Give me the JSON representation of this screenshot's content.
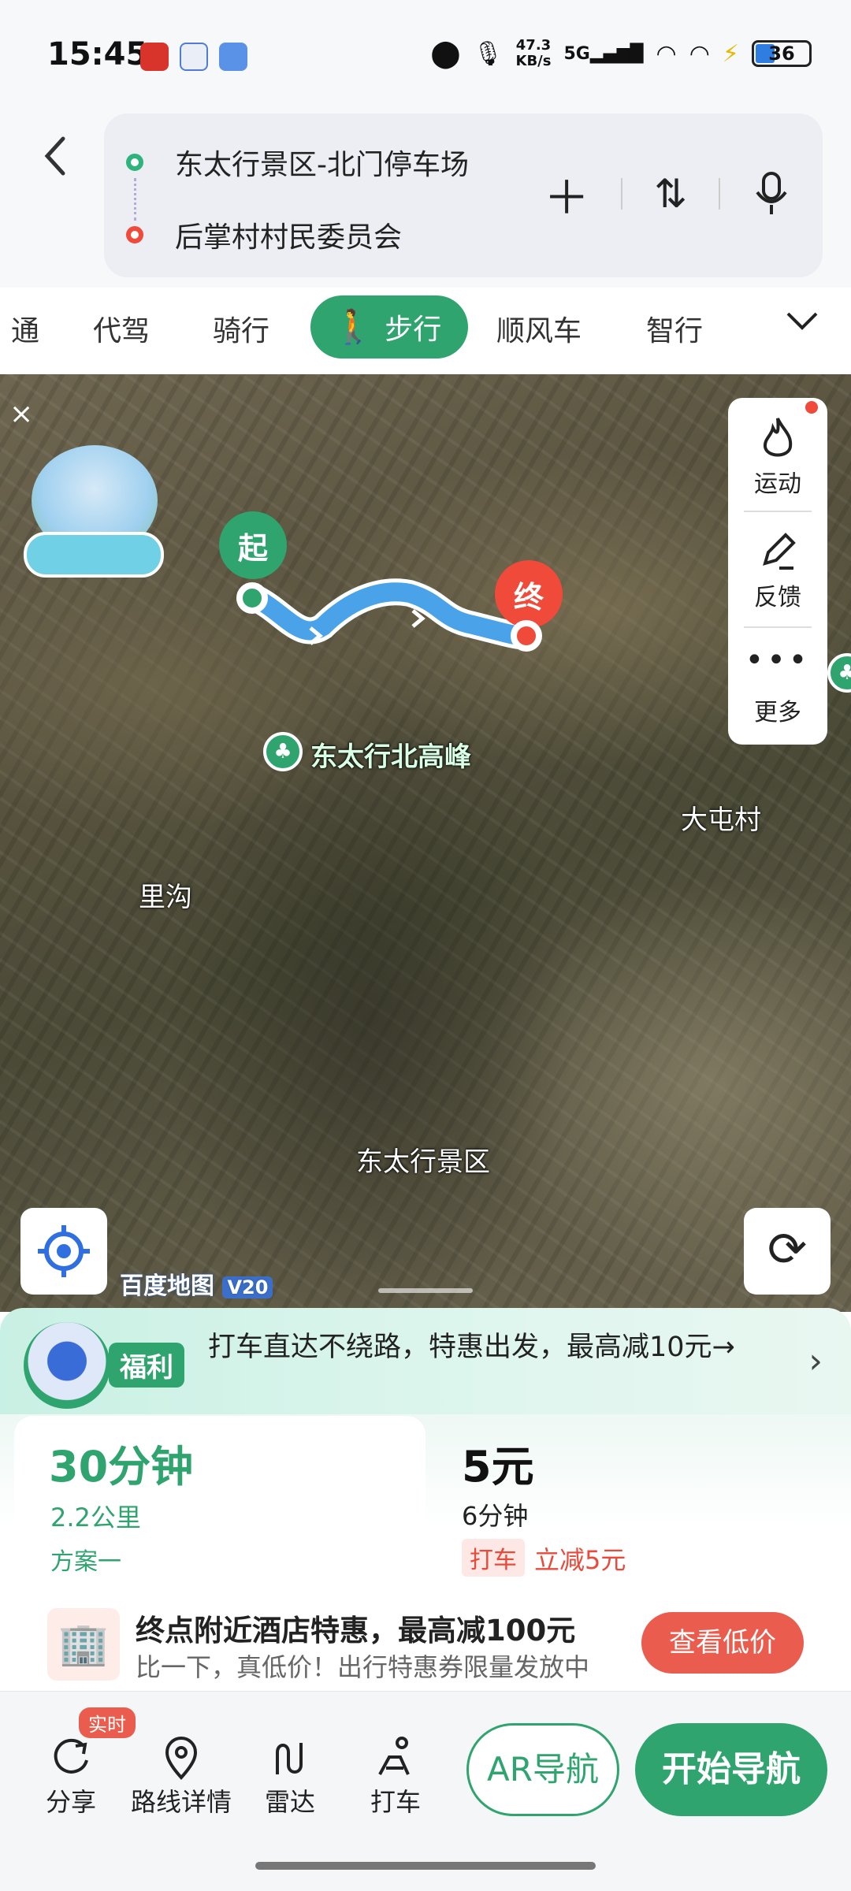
{
  "status_bar": {
    "time": "15:45",
    "net_speed_value": "47.3",
    "net_speed_unit": "KB/s",
    "network": "5G",
    "battery": "36"
  },
  "route": {
    "start": "东太行景区-北门停车场",
    "end": "后掌村村民委员会"
  },
  "tabs": [
    {
      "label": "通"
    },
    {
      "label": "代驾"
    },
    {
      "label": "骑行"
    },
    {
      "label": "步行",
      "active": true
    },
    {
      "label": "顺风车"
    },
    {
      "label": "智行"
    }
  ],
  "map": {
    "start_pin": "起",
    "end_pin": "终",
    "labels": {
      "peak": "东太行北高峰",
      "village1": "大屯村",
      "village2": "里沟",
      "scenic": "东太行景区"
    },
    "side_panel": [
      {
        "icon": "flame-icon",
        "label": "运动"
      },
      {
        "icon": "edit-icon",
        "label": "反馈"
      },
      {
        "icon": "more-icon",
        "label": "更多"
      }
    ],
    "brand": "百度地图",
    "brand_version": "V20",
    "close_glyph": "×"
  },
  "promo": {
    "badge": "福利",
    "text": "打车直达不绕路，特惠出发，最高减10元→"
  },
  "plans": {
    "plan1": {
      "time": "30分钟",
      "distance": "2.2公里",
      "tag": "方案一"
    },
    "plan2": {
      "price": "5元",
      "time": "6分钟",
      "tag": "打车",
      "discount": "立减5元"
    }
  },
  "hotel": {
    "title": "终点附近酒店特惠，最高减100元",
    "subtitle": "比一下，真低价！出行特惠券限量发放中",
    "button": "查看低价"
  },
  "toolbar": {
    "realtime_badge": "实时",
    "items": [
      {
        "icon": "share-icon",
        "label": "分享"
      },
      {
        "icon": "route-detail-icon",
        "label": "路线详情"
      },
      {
        "icon": "radar-icon",
        "label": "雷达"
      },
      {
        "icon": "taxi-icon",
        "label": "打车"
      }
    ],
    "ar_button": "AR导航",
    "start_button": "开始导航"
  },
  "colors": {
    "accent_green": "#2fa46f",
    "end_red": "#f04a3a",
    "route_blue": "#4aa3e8"
  }
}
